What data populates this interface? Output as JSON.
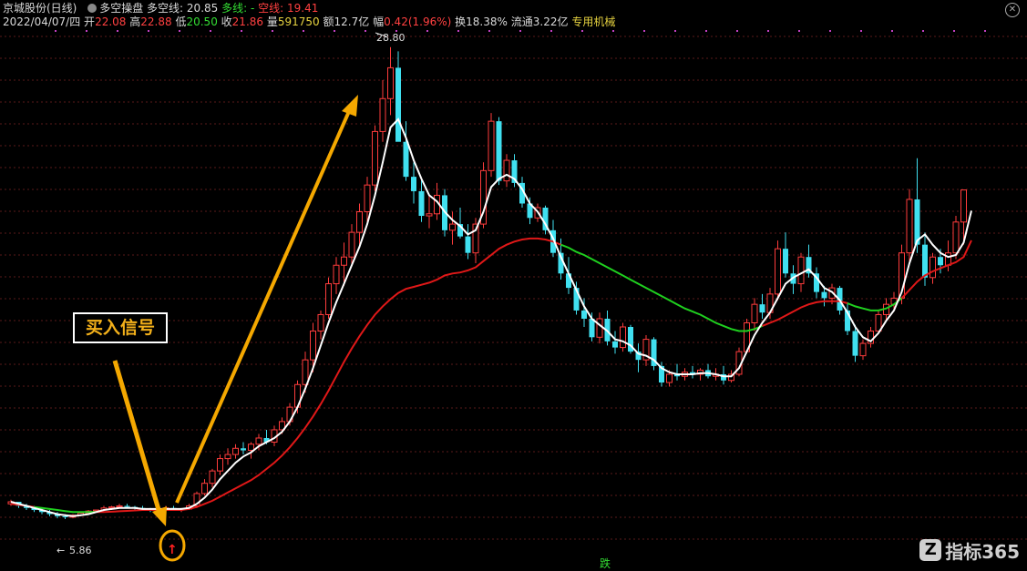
{
  "header": {
    "stock_name": "京城股份(日线)",
    "indicator_name": "多空操盘",
    "duokong_label": "多空线:",
    "duokong_value": "20.85",
    "duo_label": "多线:",
    "duo_value": "-",
    "kong_label": "空线:",
    "kong_value": "19.41"
  },
  "quote": {
    "date": "2022/04/07/四",
    "open_label": "开",
    "open": "22.08",
    "high_label": "高",
    "high": "22.88",
    "low_label": "低",
    "low": "20.50",
    "close_label": "收",
    "close": "21.86",
    "volume_label": "量",
    "volume": "591750",
    "amount_label": "额",
    "amount": "12.7亿",
    "change_label": "幅",
    "change": "0.42(1.96%)",
    "turnover_label": "换",
    "turnover": "18.38%",
    "float_label": "流通",
    "float": "3.22亿",
    "sector": "专用机械"
  },
  "annotations": {
    "buy_signal": "买入信号",
    "high_label": "28.80",
    "low_label": "5.86",
    "die_label": "跌"
  },
  "logo": {
    "text": "指标365",
    "mark": "Z"
  },
  "colors": {
    "up": "#ff3c3c",
    "down": "#40e0f0",
    "white_line": "#ffffff",
    "red_line": "#e01818",
    "green_line": "#1fd01f",
    "arrow": "#f5a800"
  },
  "chart_data": {
    "type": "candlestick",
    "ylim": [
      4,
      29.5
    ],
    "candles": [
      [
        6.6,
        6.8,
        6.5,
        6.7
      ],
      [
        6.7,
        6.7,
        6.4,
        6.5
      ],
      [
        6.5,
        6.6,
        6.3,
        6.4
      ],
      [
        6.4,
        6.5,
        6.2,
        6.3
      ],
      [
        6.3,
        6.4,
        6.1,
        6.2
      ],
      [
        6.2,
        6.3,
        6.0,
        6.1
      ],
      [
        6.1,
        6.2,
        5.9,
        6.0
      ],
      [
        6.0,
        6.1,
        5.86,
        5.95
      ],
      [
        5.95,
        6.1,
        5.9,
        6.05
      ],
      [
        6.05,
        6.2,
        6.0,
        6.15
      ],
      [
        6.15,
        6.3,
        6.1,
        6.25
      ],
      [
        6.25,
        6.3,
        6.2,
        6.3
      ],
      [
        6.3,
        6.5,
        6.2,
        6.4
      ],
      [
        6.4,
        6.5,
        6.3,
        6.45
      ],
      [
        6.45,
        6.6,
        6.4,
        6.5
      ],
      [
        6.5,
        6.6,
        6.4,
        6.45
      ],
      [
        6.45,
        6.5,
        6.3,
        6.4
      ],
      [
        6.4,
        6.5,
        6.3,
        6.35
      ],
      [
        6.35,
        6.4,
        6.2,
        6.3
      ],
      [
        6.3,
        6.4,
        6.2,
        6.35
      ],
      [
        6.35,
        6.5,
        6.2,
        6.4
      ],
      [
        6.4,
        6.5,
        6.3,
        6.3
      ],
      [
        6.3,
        6.4,
        6.2,
        6.35
      ],
      [
        6.35,
        6.6,
        6.3,
        6.5
      ],
      [
        6.5,
        7.2,
        6.4,
        7.1
      ],
      [
        7.1,
        7.8,
        7.0,
        7.6
      ],
      [
        7.6,
        8.3,
        7.4,
        8.2
      ],
      [
        8.2,
        9.0,
        8.0,
        8.8
      ],
      [
        8.8,
        9.3,
        8.5,
        9.0
      ],
      [
        9.0,
        9.5,
        8.8,
        9.3
      ],
      [
        9.3,
        9.6,
        9.0,
        9.2
      ],
      [
        9.2,
        9.6,
        8.8,
        9.5
      ],
      [
        9.5,
        10.0,
        9.2,
        9.8
      ],
      [
        9.8,
        10.2,
        9.5,
        9.6
      ],
      [
        9.6,
        10.4,
        9.4,
        10.2
      ],
      [
        10.2,
        10.8,
        10.0,
        10.6
      ],
      [
        10.6,
        11.5,
        10.4,
        11.3
      ],
      [
        11.3,
        12.6,
        11.0,
        12.4
      ],
      [
        12.4,
        14.0,
        12.0,
        13.6
      ],
      [
        13.6,
        15.4,
        13.0,
        15.0
      ],
      [
        15.0,
        16.0,
        14.6,
        15.8
      ],
      [
        15.8,
        17.6,
        15.6,
        17.3
      ],
      [
        17.3,
        18.6,
        16.8,
        18.2
      ],
      [
        18.2,
        19.3,
        17.2,
        18.6
      ],
      [
        18.6,
        20.2,
        18.2,
        19.8
      ],
      [
        19.8,
        21.2,
        19.2,
        20.8
      ],
      [
        20.8,
        22.5,
        20.2,
        22.1
      ],
      [
        22.1,
        25.0,
        21.8,
        24.7
      ],
      [
        24.7,
        27.2,
        24.2,
        26.3
      ],
      [
        26.3,
        28.8,
        25.5,
        27.8
      ],
      [
        27.8,
        28.6,
        25.0,
        24.2
      ],
      [
        24.2,
        25.2,
        22.3,
        22.5
      ],
      [
        22.5,
        23.2,
        21.2,
        21.8
      ],
      [
        21.8,
        22.4,
        20.3,
        20.6
      ],
      [
        20.6,
        21.6,
        20.0,
        20.7
      ],
      [
        20.7,
        22.2,
        20.4,
        21.6
      ],
      [
        21.6,
        21.9,
        19.6,
        19.9
      ],
      [
        19.9,
        20.8,
        19.2,
        20.2
      ],
      [
        20.2,
        21.0,
        19.5,
        19.6
      ],
      [
        19.6,
        20.2,
        18.5,
        18.8
      ],
      [
        18.8,
        20.5,
        18.3,
        20.2
      ],
      [
        20.2,
        23.2,
        20.0,
        22.8
      ],
      [
        22.8,
        25.6,
        22.5,
        25.2
      ],
      [
        25.2,
        25.4,
        22.1,
        22.3
      ],
      [
        22.3,
        23.6,
        22.0,
        23.3
      ],
      [
        23.3,
        23.6,
        22.0,
        22.2
      ],
      [
        22.2,
        22.5,
        21.0,
        21.2
      ],
      [
        21.2,
        21.5,
        20.2,
        20.5
      ],
      [
        20.5,
        21.2,
        20.3,
        21.0
      ],
      [
        21.0,
        21.1,
        19.7,
        19.9
      ],
      [
        19.9,
        20.4,
        18.6,
        18.8
      ],
      [
        18.8,
        19.5,
        17.5,
        17.8
      ],
      [
        17.8,
        18.6,
        16.8,
        17.1
      ],
      [
        17.1,
        17.4,
        15.8,
        16.0
      ],
      [
        16.0,
        16.6,
        15.2,
        15.6
      ],
      [
        15.6,
        15.9,
        14.5,
        14.7
      ],
      [
        14.7,
        15.9,
        14.4,
        15.6
      ],
      [
        15.6,
        16.0,
        14.3,
        14.5
      ],
      [
        14.5,
        15.0,
        13.9,
        14.2
      ],
      [
        14.2,
        15.4,
        14.0,
        15.2
      ],
      [
        15.2,
        15.3,
        13.9,
        14.0
      ],
      [
        14.0,
        14.4,
        13.0,
        13.6
      ],
      [
        13.6,
        14.8,
        13.3,
        14.6
      ],
      [
        14.6,
        14.7,
        13.1,
        13.3
      ],
      [
        13.3,
        13.5,
        12.3,
        12.5
      ],
      [
        12.5,
        13.1,
        12.3,
        12.9
      ],
      [
        12.9,
        13.4,
        12.6,
        12.8
      ],
      [
        12.8,
        13.2,
        12.6,
        13.0
      ],
      [
        13.0,
        13.3,
        12.7,
        12.9
      ],
      [
        12.9,
        13.2,
        12.6,
        13.1
      ],
      [
        13.1,
        13.4,
        12.7,
        12.8
      ],
      [
        12.8,
        13.2,
        12.6,
        12.9
      ],
      [
        12.9,
        13.3,
        12.4,
        12.6
      ],
      [
        12.6,
        13.1,
        12.5,
        12.9
      ],
      [
        12.9,
        14.2,
        12.8,
        14.0
      ],
      [
        14.0,
        15.6,
        13.9,
        15.4
      ],
      [
        15.4,
        16.6,
        15.0,
        16.3
      ],
      [
        16.3,
        16.8,
        15.6,
        15.9
      ],
      [
        15.9,
        17.1,
        15.6,
        16.8
      ],
      [
        16.8,
        19.4,
        16.5,
        19.0
      ],
      [
        19.0,
        19.8,
        17.6,
        17.8
      ],
      [
        17.8,
        18.2,
        16.8,
        17.3
      ],
      [
        17.3,
        18.8,
        16.9,
        18.6
      ],
      [
        18.6,
        19.2,
        17.6,
        17.8
      ],
      [
        17.8,
        18.1,
        16.6,
        16.9
      ],
      [
        16.9,
        17.2,
        16.2,
        16.6
      ],
      [
        16.6,
        17.3,
        16.3,
        17.1
      ],
      [
        17.1,
        17.2,
        15.8,
        16.0
      ],
      [
        16.0,
        16.4,
        14.8,
        15.0
      ],
      [
        15.0,
        15.3,
        13.5,
        13.8
      ],
      [
        13.8,
        14.6,
        13.6,
        14.4
      ],
      [
        14.4,
        15.2,
        14.2,
        15.0
      ],
      [
        15.0,
        16.0,
        14.9,
        15.8
      ],
      [
        15.8,
        16.6,
        15.5,
        16.3
      ],
      [
        16.3,
        16.9,
        16.0,
        16.6
      ],
      [
        16.6,
        19.2,
        16.3,
        18.8
      ],
      [
        18.8,
        21.9,
        18.3,
        21.4
      ],
      [
        21.4,
        23.4,
        18.8,
        19.2
      ],
      [
        19.2,
        19.8,
        17.2,
        17.6
      ],
      [
        17.6,
        18.8,
        17.3,
        18.6
      ],
      [
        18.6,
        19.0,
        17.8,
        18.2
      ],
      [
        18.2,
        19.4,
        17.9,
        18.8
      ],
      [
        18.8,
        20.6,
        18.5,
        20.3
      ],
      [
        20.3,
        20.9,
        19.2,
        21.86
      ]
    ],
    "white_line": [
      6.7,
      6.6,
      6.5,
      6.4,
      6.3,
      6.2,
      6.1,
      6.05,
      6.0,
      6.05,
      6.1,
      6.2,
      6.3,
      6.35,
      6.4,
      6.4,
      6.4,
      6.35,
      6.35,
      6.35,
      6.35,
      6.35,
      6.35,
      6.4,
      6.6,
      6.9,
      7.3,
      7.8,
      8.2,
      8.6,
      8.9,
      9.1,
      9.4,
      9.6,
      9.8,
      10.1,
      10.6,
      11.3,
      12.2,
      13.2,
      14.3,
      15.4,
      16.4,
      17.3,
      18.2,
      19.1,
      20.2,
      21.6,
      23.2,
      24.9,
      25.3,
      24.4,
      23.3,
      22.4,
      21.6,
      21.3,
      20.8,
      20.4,
      20.1,
      19.7,
      19.9,
      20.8,
      22.0,
      22.4,
      22.6,
      22.4,
      21.9,
      21.2,
      20.8,
      20.2,
      19.5,
      18.6,
      17.8,
      17.0,
      16.2,
      15.6,
      15.3,
      15.0,
      14.6,
      14.5,
      14.3,
      13.9,
      13.8,
      13.6,
      13.2,
      13.0,
      12.9,
      12.9,
      12.9,
      12.95,
      12.95,
      12.9,
      12.8,
      12.8,
      13.2,
      14.0,
      14.8,
      15.4,
      15.9,
      16.6,
      17.3,
      17.6,
      17.8,
      18.0,
      17.6,
      17.1,
      16.9,
      16.5,
      15.9,
      15.2,
      14.7,
      14.5,
      14.9,
      15.5,
      16.0,
      16.9,
      18.3,
      19.4,
      19.7,
      19.2,
      18.8,
      18.6,
      18.7,
      19.3,
      20.85
    ],
    "red_line": [
      6.6,
      6.55,
      6.5,
      6.45,
      6.4,
      6.35,
      6.3,
      6.25,
      6.2,
      6.2,
      6.2,
      6.2,
      6.2,
      6.22,
      6.24,
      6.26,
      6.28,
      6.3,
      6.3,
      6.3,
      6.3,
      6.3,
      6.3,
      6.35,
      6.45,
      6.6,
      6.75,
      6.95,
      7.15,
      7.35,
      7.55,
      7.75,
      8.0,
      8.3,
      8.6,
      8.95,
      9.35,
      9.8,
      10.3,
      10.85,
      11.45,
      12.1,
      12.8,
      13.5,
      14.15,
      14.75,
      15.3,
      15.8,
      16.2,
      16.55,
      16.85,
      17.05,
      17.15,
      17.25,
      17.35,
      17.5,
      17.7,
      17.8,
      17.85,
      17.95,
      18.1,
      18.4,
      18.7,
      19.0,
      19.2,
      19.35,
      19.45,
      19.5,
      19.5,
      19.45,
      19.35,
      19.2,
      19.05,
      18.85,
      18.7,
      18.5,
      18.3,
      18.1,
      17.9,
      17.7,
      17.5,
      17.3,
      17.1,
      16.9,
      16.7,
      16.5,
      16.3,
      16.1,
      15.95,
      15.8,
      15.6,
      15.4,
      15.25,
      15.1,
      15.0,
      15.0,
      15.1,
      15.25,
      15.4,
      15.55,
      15.75,
      15.95,
      16.15,
      16.3,
      16.4,
      16.45,
      16.45,
      16.45,
      16.35,
      16.2,
      16.1,
      16.0,
      16.0,
      16.1,
      16.3,
      16.6,
      17.0,
      17.4,
      17.7,
      17.9,
      18.05,
      18.2,
      18.35,
      18.6,
      19.41
    ]
  }
}
